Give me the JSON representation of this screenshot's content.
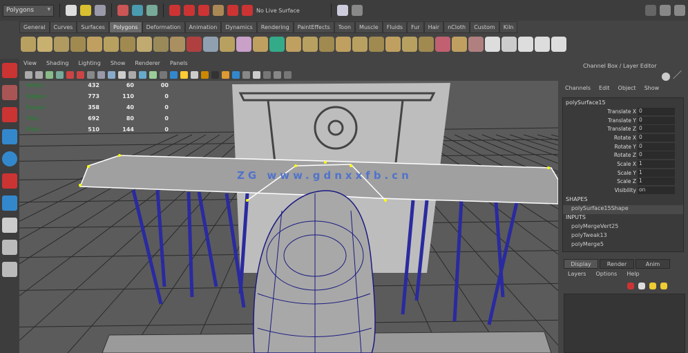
{
  "status_line": {
    "mode": "Polygons",
    "live_surface": "No Live Surface"
  },
  "shelf_tabs": [
    "General",
    "Curves",
    "Surfaces",
    "Polygons",
    "Deformation",
    "Animation",
    "Dynamics",
    "Rendering",
    "PaintEffects",
    "Toon",
    "Muscle",
    "Fluids",
    "Fur",
    "Hair",
    "nCloth",
    "Custom",
    "Kiln"
  ],
  "active_shelf": "Polygons",
  "panel_menu": [
    "View",
    "Shading",
    "Lighting",
    "Show",
    "Renderer",
    "Panels"
  ],
  "hud": [
    {
      "label": "Verts:",
      "v": [
        "432",
        "60",
        "00"
      ]
    },
    {
      "label": "Edges:",
      "v": [
        "773",
        "110",
        "0"
      ]
    },
    {
      "label": "Faces:",
      "v": [
        "358",
        "40",
        "0"
      ]
    },
    {
      "label": "Tris:",
      "v": [
        "692",
        "80",
        "0"
      ]
    },
    {
      "label": "UVs:",
      "v": [
        "510",
        "144",
        "0"
      ]
    }
  ],
  "watermark": "ZG  www.gdnxxfb.cn",
  "channel_box": {
    "title": "Channel Box / Layer Editor",
    "menu": [
      "Channels",
      "Edit",
      "Object",
      "Show"
    ],
    "object": "polySurface15",
    "attrs": [
      {
        "n": "Translate X",
        "v": "0"
      },
      {
        "n": "Translate Y",
        "v": "0"
      },
      {
        "n": "Translate Z",
        "v": "0"
      },
      {
        "n": "Rotate X",
        "v": "0"
      },
      {
        "n": "Rotate Y",
        "v": "0"
      },
      {
        "n": "Rotate Z",
        "v": "0"
      },
      {
        "n": "Scale X",
        "v": "1"
      },
      {
        "n": "Scale Y",
        "v": "1"
      },
      {
        "n": "Scale Z",
        "v": "1"
      },
      {
        "n": "Visibility",
        "v": "on"
      }
    ],
    "shapes_label": "SHAPES",
    "shape": "polySurface15Shape",
    "inputs_label": "INPUTS",
    "inputs": [
      "polyMergeVert25",
      "polyTweak13",
      "polyMerge5"
    ]
  },
  "layer_editor": {
    "tabs": [
      "Display",
      "Render",
      "Anim"
    ],
    "menu": [
      "Layers",
      "Options",
      "Help"
    ]
  },
  "colors": {
    "bg": "#444444",
    "viewport": "#5b5b5b",
    "wire": "#1a1a80",
    "selection": "#ffff00"
  }
}
